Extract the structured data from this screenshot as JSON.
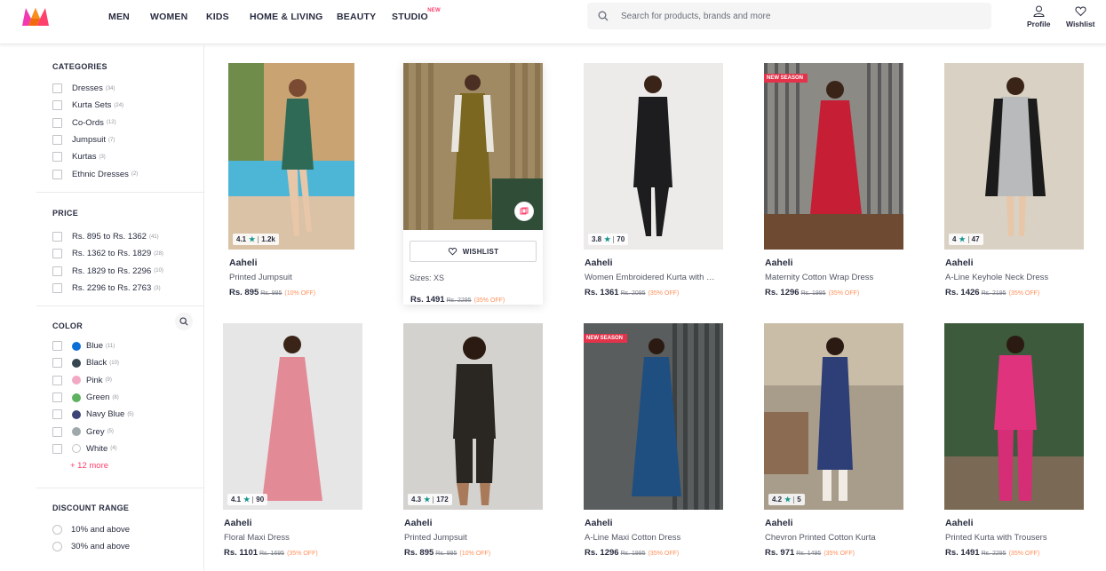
{
  "nav": {
    "items": [
      "MEN",
      "WOMEN",
      "KIDS",
      "HOME & LIVING",
      "BEAUTY",
      "STUDIO"
    ],
    "studio_badge": "NEW"
  },
  "search": {
    "placeholder": "Search for products, brands and more"
  },
  "header_actions": {
    "profile": "Profile",
    "wishlist": "Wishlist"
  },
  "filters": {
    "categories": {
      "title": "CATEGORIES",
      "options": [
        {
          "label": "Dresses",
          "count": "(34)"
        },
        {
          "label": "Kurta Sets",
          "count": "(24)"
        },
        {
          "label": "Co-Ords",
          "count": "(12)"
        },
        {
          "label": "Jumpsuit",
          "count": "(7)"
        },
        {
          "label": "Kurtas",
          "count": "(3)"
        },
        {
          "label": "Ethnic Dresses",
          "count": "(2)"
        }
      ]
    },
    "price": {
      "title": "PRICE",
      "options": [
        {
          "label": "Rs. 895 to Rs. 1362",
          "count": "(41)"
        },
        {
          "label": "Rs. 1362 to Rs. 1829",
          "count": "(28)"
        },
        {
          "label": "Rs. 1829 to Rs. 2296",
          "count": "(10)"
        },
        {
          "label": "Rs. 2296 to Rs. 2763",
          "count": "(3)"
        }
      ]
    },
    "color": {
      "title": "COLOR",
      "options": [
        {
          "label": "Blue",
          "count": "(11)",
          "color": "#0b6fd6"
        },
        {
          "label": "Black",
          "count": "(10)",
          "color": "#36454f"
        },
        {
          "label": "Pink",
          "count": "(9)",
          "color": "#f1a9c4"
        },
        {
          "label": "Green",
          "count": "(8)",
          "color": "#5eb160"
        },
        {
          "label": "Navy Blue",
          "count": "(5)",
          "color": "#3c4477"
        },
        {
          "label": "Grey",
          "count": "(5)",
          "color": "#9fa8ab"
        },
        {
          "label": "White",
          "count": "(4)",
          "color": "#ffffff"
        }
      ],
      "more": "+ 12 more"
    },
    "discount": {
      "title": "DISCOUNT RANGE",
      "options": [
        "10% and above",
        "30% and above"
      ]
    }
  },
  "products": [
    {
      "brand": "Aaheli",
      "name": "Printed Jumpsuit",
      "price": "Rs. 895",
      "mrp": "Rs. 995",
      "off": "(10% OFF)",
      "rating": "4.1",
      "reviews": "1.2k",
      "badge": ""
    },
    {
      "brand": "Aaheli",
      "name": "",
      "price": "Rs. 1491",
      "mrp": "Rs. 2295",
      "off": "(35% OFF)",
      "rating": "",
      "reviews": "",
      "badge": "",
      "hovered": true,
      "wishlist_label": "WISHLIST",
      "sizes": "Sizes: XS"
    },
    {
      "brand": "Aaheli",
      "name": "Women Embroidered Kurta with Trousers",
      "price": "Rs. 1361",
      "mrp": "Rs. 2095",
      "off": "(35% OFF)",
      "rating": "3.8",
      "reviews": "70",
      "badge": ""
    },
    {
      "brand": "Aaheli",
      "name": "Maternity Cotton Wrap Dress",
      "price": "Rs. 1296",
      "mrp": "Rs. 1995",
      "off": "(35% OFF)",
      "rating": "",
      "reviews": "",
      "badge": "NEW SEASON"
    },
    {
      "brand": "Aaheli",
      "name": "A-Line Keyhole Neck Dress",
      "price": "Rs. 1426",
      "mrp": "Rs. 2195",
      "off": "(35% OFF)",
      "rating": "4",
      "reviews": "47",
      "badge": ""
    },
    {
      "brand": "Aaheli",
      "name": "Floral Maxi Dress",
      "price": "Rs. 1101",
      "mrp": "Rs. 1695",
      "off": "(35% OFF)",
      "rating": "4.1",
      "reviews": "90",
      "badge": ""
    },
    {
      "brand": "Aaheli",
      "name": "Printed Jumpsuit",
      "price": "Rs. 895",
      "mrp": "Rs. 995",
      "off": "(10% OFF)",
      "rating": "4.3",
      "reviews": "172",
      "badge": ""
    },
    {
      "brand": "Aaheli",
      "name": "A-Line Maxi Cotton Dress",
      "price": "Rs. 1296",
      "mrp": "Rs. 1995",
      "off": "(35% OFF)",
      "rating": "",
      "reviews": "",
      "badge": "NEW SEASON"
    },
    {
      "brand": "Aaheli",
      "name": "Chevron Printed Cotton Kurta",
      "price": "Rs. 971",
      "mrp": "Rs. 1495",
      "off": "(35% OFF)",
      "rating": "4.2",
      "reviews": "5",
      "badge": ""
    },
    {
      "brand": "Aaheli",
      "name": "Printed Kurta with Trousers",
      "price": "Rs. 1491",
      "mrp": "Rs. 2295",
      "off": "(35% OFF)",
      "rating": "",
      "reviews": "",
      "badge": ""
    }
  ],
  "colors": {
    "accent": "#ff3f6c",
    "discount": "#ff905a",
    "star": "#14958f"
  }
}
